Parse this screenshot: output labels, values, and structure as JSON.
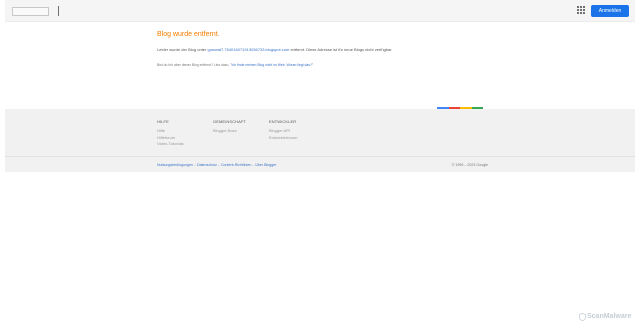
{
  "header": {
    "signin_label": "Anmelden",
    "apps_icon": "apps-grid-icon"
  },
  "main": {
    "title": "Blog wurde entfernt.",
    "desc_prefix": "Leider wurde der Blog unter ",
    "desc_link": "gowwat7.754016071913036733.blogspot.com",
    "desc_suffix": " entfernt. Diese Adresse ist für neue Blogs nicht verfügbar.",
    "owner_prefix": "Bist du Inh aber dieser Blog entfernt? Lies dazu, ",
    "owner_link": "\"Ich finde meinen Blog nicht im Web. Woran liegt das?\""
  },
  "brand_colors": [
    "#4285f4",
    "#ea4335",
    "#fbbc05",
    "#34a853"
  ],
  "footer": {
    "columns": [
      {
        "title": "HILFE",
        "links": [
          "Hilfe",
          "Hilfeforum",
          "Video-Tutorials"
        ]
      },
      {
        "title": "GEMEINSCHAFT",
        "links": [
          "Blogger Buzz"
        ]
      },
      {
        "title": "ENTWICKLER",
        "links": [
          "Blogger API",
          "Entwicklerforum"
        ]
      }
    ],
    "bottom_links": [
      "Nutzungsbedingungen",
      "Datenschutz",
      "Content-Richtlinien",
      "Über Blogger"
    ],
    "copyright": "© 1999 – 2023 Google"
  },
  "watermark": {
    "text": "ScanMalware",
    "icon": "shield-icon"
  }
}
